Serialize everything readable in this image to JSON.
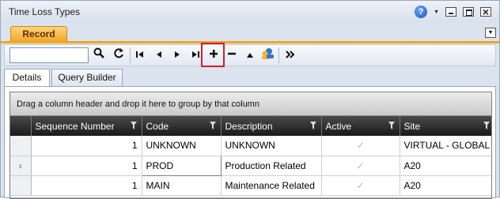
{
  "window": {
    "title": "Time Loss Types"
  },
  "tabs": {
    "record": "Record"
  },
  "toolbar": {
    "search_value": "",
    "buttons": {
      "search": "search-icon",
      "refresh": "refresh-icon",
      "first": "first-record-icon",
      "prev": "previous-record-icon",
      "next": "next-record-icon",
      "last": "last-record-icon",
      "add": "plus-icon",
      "delete": "minus-icon",
      "up": "up-triangle-icon",
      "users": "users-icon",
      "more": "more-icon"
    }
  },
  "subtabs": {
    "details": "Details",
    "query_builder": "Query Builder"
  },
  "grid": {
    "group_hint": "Drag a column header and drop it here to group by that column",
    "columns": [
      "Sequence Number",
      "Code",
      "Description",
      "Active",
      "Site"
    ],
    "rows": [
      {
        "seq": "1",
        "code": "UNKNOWN",
        "description": "UNKNOWN",
        "active": true,
        "site": "VIRTUAL - GLOBAL"
      },
      {
        "seq": "1",
        "code": "PROD",
        "description": "Production Related",
        "active": true,
        "site": "A20"
      },
      {
        "seq": "1",
        "code": "MAIN",
        "description": "Maintenance Related",
        "active": true,
        "site": "A20"
      }
    ]
  },
  "colors": {
    "accent": "#f2a623",
    "highlight": "#d0202a"
  }
}
